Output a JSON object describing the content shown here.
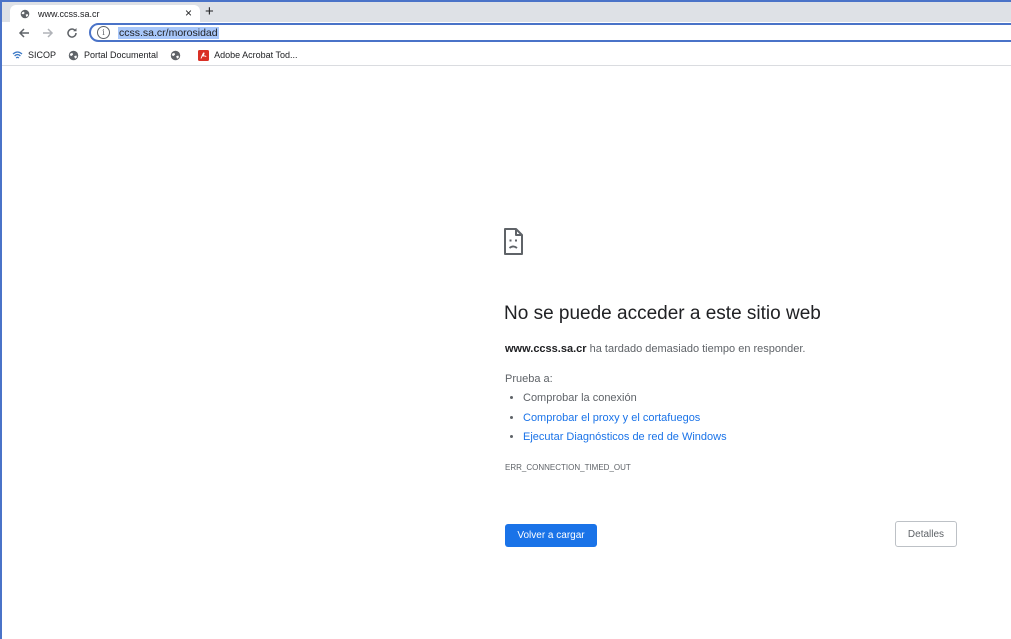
{
  "browser": {
    "tab": {
      "title": "www.ccss.sa.cr",
      "close_label": "×",
      "favicon": "globe-icon"
    },
    "new_tab_label": "+",
    "address_bar": {
      "url": "ccss.sa.cr/morosidad",
      "security_icon": "info-icon"
    },
    "bookmarks": [
      {
        "label": "SICOP",
        "icon": "wifi-icon"
      },
      {
        "label": "Portal Documental",
        "icon": "globe-icon"
      },
      {
        "label": "",
        "icon": "globe-icon"
      },
      {
        "label": "Adobe Acrobat Tod...",
        "icon": "pdf-icon"
      }
    ]
  },
  "error_page": {
    "icon": "sad-page-icon",
    "title": "No se puede acceder a este sitio web",
    "host": "www.ccss.sa.cr",
    "description_rest": " ha tardado demasiado tiempo en responder.",
    "try_label": "Prueba a:",
    "suggestions": [
      {
        "text": "Comprobar la conexión",
        "is_link": false
      },
      {
        "text": "Comprobar el proxy y el cortafuegos",
        "is_link": true
      },
      {
        "text": "Ejecutar Diagnósticos de red de Windows",
        "is_link": true
      }
    ],
    "error_code": "ERR_CONNECTION_TIMED_OUT",
    "reload_label": "Volver a cargar",
    "details_label": "Detalles"
  },
  "colors": {
    "accent": "#1a73e8",
    "frame": "#dee1e6",
    "selection": "#a8c7fa"
  }
}
